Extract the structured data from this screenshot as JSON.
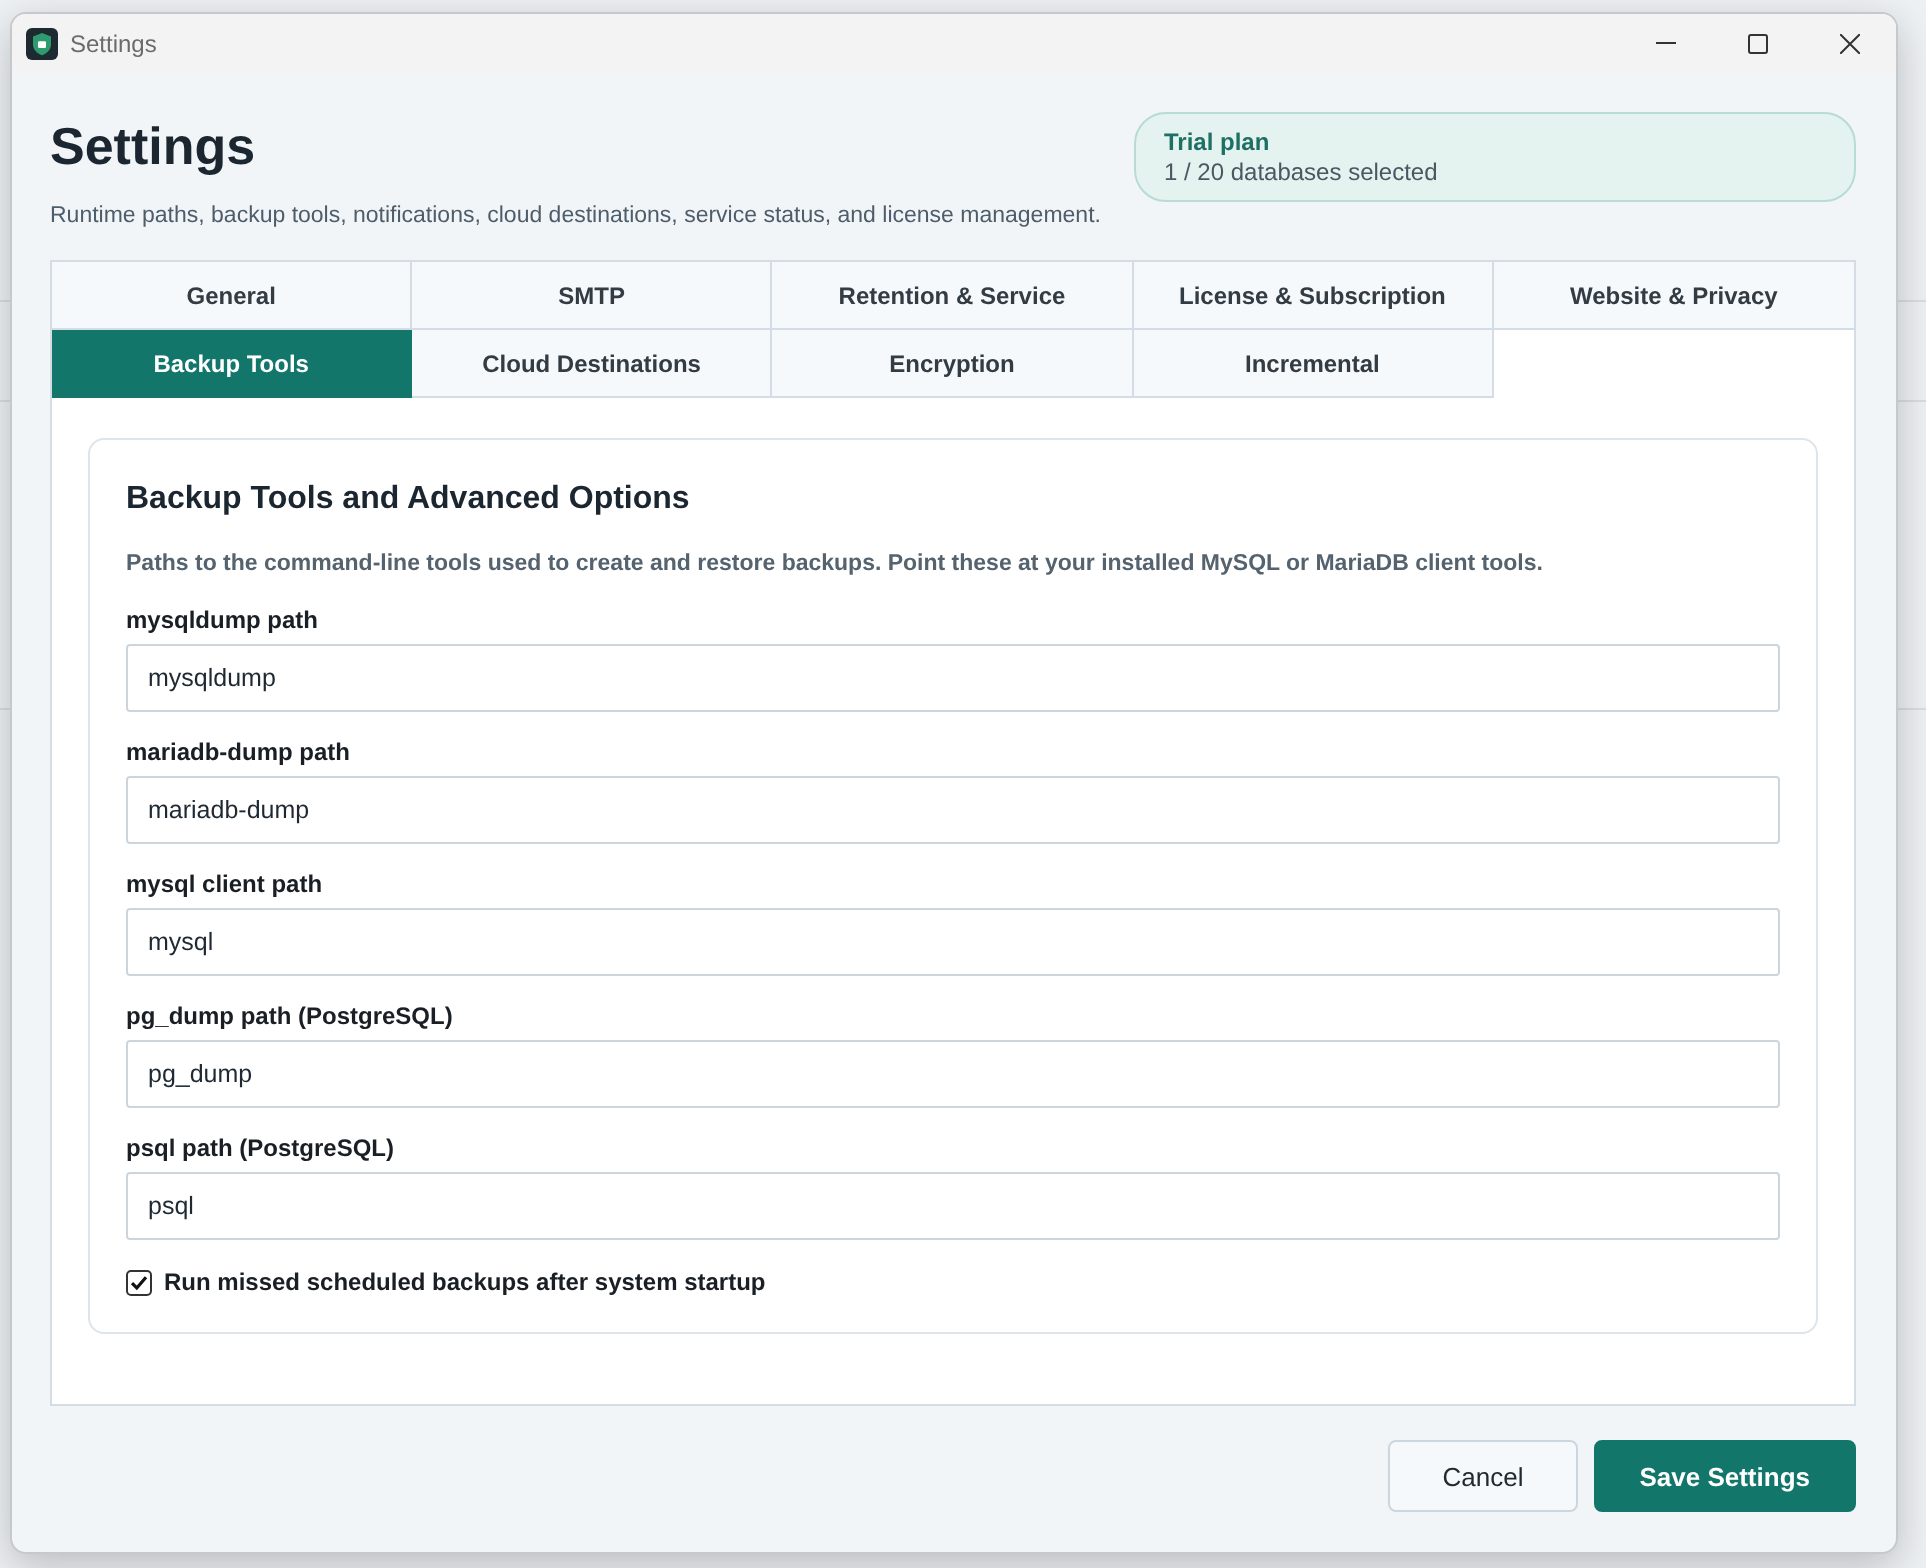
{
  "window": {
    "title": "Settings"
  },
  "header": {
    "title": "Settings",
    "subtitle": "Runtime paths, backup tools, notifications, cloud destinations, service status, and license management."
  },
  "plan": {
    "title": "Trial plan",
    "detail": "1 / 20 databases selected"
  },
  "tabs": [
    {
      "label": "General",
      "selected": false
    },
    {
      "label": "SMTP",
      "selected": false
    },
    {
      "label": "Retention & Service",
      "selected": false
    },
    {
      "label": "License & Subscription",
      "selected": false
    },
    {
      "label": "Website & Privacy",
      "selected": false
    },
    {
      "label": "Backup Tools",
      "selected": true
    },
    {
      "label": "Cloud Destinations",
      "selected": false
    },
    {
      "label": "Encryption",
      "selected": false
    },
    {
      "label": "Incremental",
      "selected": false
    }
  ],
  "section": {
    "title": "Backup Tools and Advanced Options",
    "description": "Paths to the command-line tools used to create and restore backups. Point these at your installed MySQL or MariaDB client tools.",
    "fields": [
      {
        "label": "mysqldump path",
        "value": "mysqldump"
      },
      {
        "label": "mariadb-dump path",
        "value": "mariadb-dump"
      },
      {
        "label": "mysql client path",
        "value": "mysql"
      },
      {
        "label": "pg_dump path (PostgreSQL)",
        "value": "pg_dump"
      },
      {
        "label": "psql path (PostgreSQL)",
        "value": "psql"
      }
    ],
    "options": [
      {
        "label": "Run missed scheduled backups after system startup",
        "checked": true
      }
    ]
  },
  "buttons": [
    {
      "label": "Cancel",
      "kind": "secondary"
    },
    {
      "label": "Save Settings",
      "kind": "primary"
    }
  ]
}
